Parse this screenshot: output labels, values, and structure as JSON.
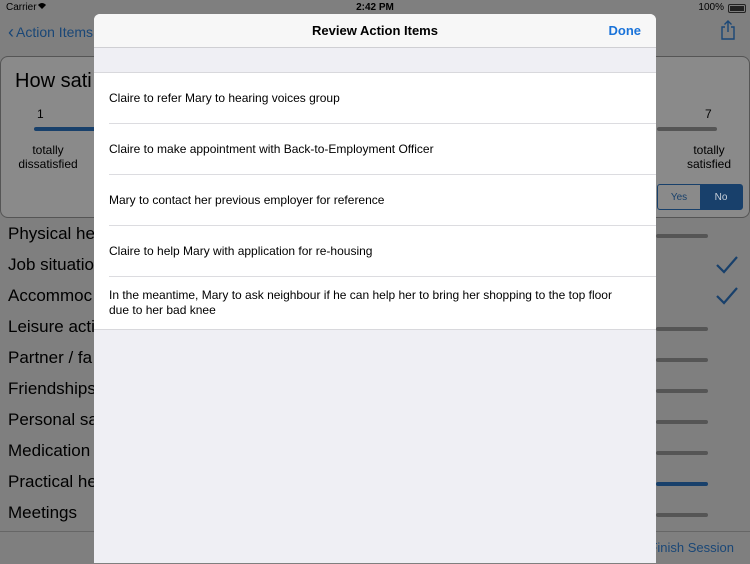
{
  "status_bar": {
    "carrier": "Carrier",
    "time": "2:42 PM",
    "battery": "100%"
  },
  "nav": {
    "back_label": "Action Items"
  },
  "question": {
    "text": "How sati",
    "scale_min": "1",
    "scale_max": "7",
    "label_min": "totally dissatisfied",
    "label_max": "totally satisfied",
    "yes_label": "Yes",
    "no_label": "No"
  },
  "domains": [
    {
      "label": "Physical he",
      "checked": false
    },
    {
      "label": "Job situatio",
      "checked": true
    },
    {
      "label": "Accommoc",
      "checked": true
    },
    {
      "label": "Leisure acti",
      "checked": false
    },
    {
      "label": "Partner / fa",
      "checked": false
    },
    {
      "label": "Friendships",
      "checked": false
    },
    {
      "label": "Personal sa",
      "checked": false
    },
    {
      "label": "Medication",
      "checked": false
    },
    {
      "label": "Practical he",
      "checked": false
    },
    {
      "label": "Meetings",
      "checked": false
    }
  ],
  "bottom_bar": {
    "finish_label": "Finish Session"
  },
  "modal": {
    "title": "Review Action Items",
    "done_label": "Done",
    "items": [
      "Claire to refer Mary to hearing voices group",
      "Claire to make appointment with Back-to-Employment Officer",
      "Mary to contact her previous employer for reference",
      "Claire to help Mary with application for re-housing",
      "In the meantime, Mary to ask neighbour if he can help her to bring her shopping to the top floor due to her bad knee"
    ]
  },
  "colors": {
    "accent": "#1a73d9",
    "dim_accent": "#18406b",
    "overlay": "#7f7f7f"
  }
}
